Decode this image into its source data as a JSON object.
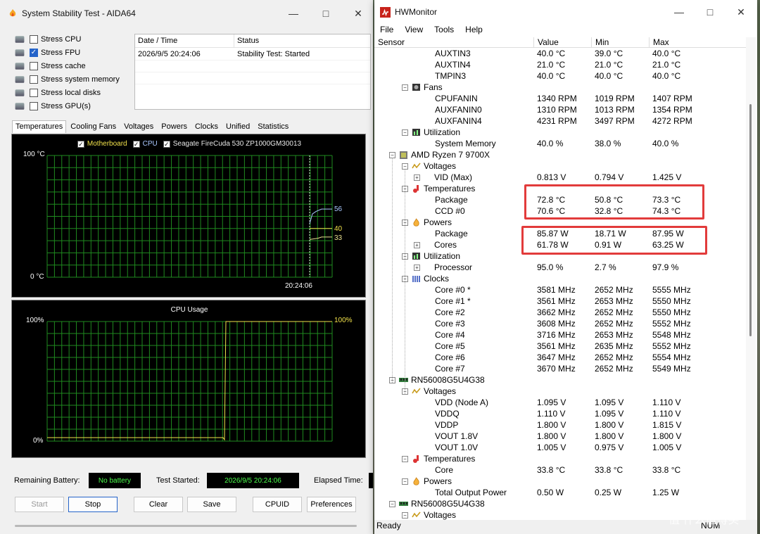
{
  "aida": {
    "title": "System Stability Test - AIDA64",
    "stress_items": [
      {
        "label": "Stress CPU",
        "checked": false,
        "icon": "cpu-chip-icon"
      },
      {
        "label": "Stress FPU",
        "checked": true,
        "icon": "fpu-icon"
      },
      {
        "label": "Stress cache",
        "checked": false,
        "icon": "cache-icon"
      },
      {
        "label": "Stress system memory",
        "checked": false,
        "icon": "memory-icon"
      },
      {
        "label": "Stress local disks",
        "checked": false,
        "icon": "disk-icon"
      },
      {
        "label": "Stress GPU(s)",
        "checked": false,
        "icon": "gpu-icon"
      }
    ],
    "log": {
      "col_datetime": "Date / Time",
      "col_status": "Status",
      "rows": [
        {
          "datetime": "2026/9/5 20:24:06",
          "status": "Stability Test: Started"
        }
      ]
    },
    "tabs": [
      "Temperatures",
      "Cooling Fans",
      "Voltages",
      "Powers",
      "Clocks",
      "Unified",
      "Statistics"
    ],
    "active_tab": "Temperatures",
    "temp_graph": {
      "legend": [
        "Motherboard",
        "CPU",
        "Seagate FireCuda 530 ZP1000GM30013"
      ],
      "y_max_label": "100 °C",
      "y_min_label": "0 °C",
      "time_label": "20:24:06",
      "readouts": [
        "56",
        "40",
        "33"
      ],
      "colors": {
        "motherboard": "#f2e24b",
        "cpu": "#aac8ff",
        "disk": "#e8e090",
        "grid": "#1f8a1f"
      }
    },
    "usage_graph": {
      "title": "CPU Usage",
      "y_max_label": "100%",
      "y_min_label": "0%",
      "readout": "100%"
    },
    "status": {
      "battery_label": "Remaining Battery:",
      "battery_value": "No battery",
      "started_label": "Test Started:",
      "started_value": "2026/9/5 20:24:06",
      "elapsed_label": "Elapsed Time:"
    },
    "buttons": {
      "start": "Start",
      "stop": "Stop",
      "clear": "Clear",
      "save": "Save",
      "cpuid": "CPUID",
      "preferences": "Preferences"
    }
  },
  "hwm": {
    "title": "HWMonitor",
    "menu": [
      "File",
      "View",
      "Tools",
      "Help"
    ],
    "columns": {
      "sensor": "Sensor",
      "value": "Value",
      "min": "Min",
      "max": "Max"
    },
    "rows": [
      {
        "level": 3,
        "name": "AUXTIN3",
        "value": "40.0 °C",
        "min": "39.0 °C",
        "max": "40.0 °C"
      },
      {
        "level": 3,
        "name": "AUXTIN4",
        "value": "21.0 °C",
        "min": "21.0 °C",
        "max": "21.0 °C"
      },
      {
        "level": 3,
        "name": "TMPIN3",
        "value": "40.0 °C",
        "min": "40.0 °C",
        "max": "40.0 °C"
      },
      {
        "level": 2,
        "name": "Fans",
        "icon": "fan-icon"
      },
      {
        "level": 3,
        "name": "CPUFANIN",
        "value": "1340 RPM",
        "min": "1019 RPM",
        "max": "1407 RPM"
      },
      {
        "level": 3,
        "name": "AUXFANIN0",
        "value": "1310 RPM",
        "min": "1013 RPM",
        "max": "1354 RPM"
      },
      {
        "level": 3,
        "name": "AUXFANIN4",
        "value": "4231 RPM",
        "min": "3497 RPM",
        "max": "4272 RPM"
      },
      {
        "level": 2,
        "name": "Utilization",
        "icon": "utilization-icon"
      },
      {
        "level": 3,
        "name": "System Memory",
        "value": "40.0 %",
        "min": "38.0 %",
        "max": "40.0 %"
      },
      {
        "level": 1,
        "name": "AMD Ryzen 7 9700X",
        "icon": "cpu-chip-icon"
      },
      {
        "level": 2,
        "name": "Voltages",
        "icon": "voltage-icon"
      },
      {
        "level": 3,
        "name": "VID (Max)",
        "value": "0.813 V",
        "min": "0.794 V",
        "max": "1.425 V",
        "plus": true
      },
      {
        "level": 2,
        "name": "Temperatures",
        "icon": "thermometer-icon"
      },
      {
        "level": 3,
        "name": "Package",
        "value": "72.8 °C",
        "min": "50.8 °C",
        "max": "73.3 °C"
      },
      {
        "level": 3,
        "name": "CCD #0",
        "value": "70.6 °C",
        "min": "32.8 °C",
        "max": "74.3 °C"
      },
      {
        "level": 2,
        "name": "Powers",
        "icon": "power-flame-icon"
      },
      {
        "level": 3,
        "name": "Package",
        "value": "85.87 W",
        "min": "18.71 W",
        "max": "87.95 W"
      },
      {
        "level": 3,
        "name": "Cores",
        "value": "61.78 W",
        "min": "0.91 W",
        "max": "63.25 W",
        "plus": true
      },
      {
        "level": 2,
        "name": "Utilization",
        "icon": "utilization-icon"
      },
      {
        "level": 3,
        "name": "Processor",
        "value": "95.0 %",
        "min": "2.7 %",
        "max": "97.9 %",
        "plus": true
      },
      {
        "level": 2,
        "name": "Clocks",
        "icon": "clock-bars-icon"
      },
      {
        "level": 3,
        "name": "Core #0 *",
        "value": "3581 MHz",
        "min": "2652 MHz",
        "max": "5555 MHz"
      },
      {
        "level": 3,
        "name": "Core #1 *",
        "value": "3561 MHz",
        "min": "2653 MHz",
        "max": "5550 MHz"
      },
      {
        "level": 3,
        "name": "Core #2",
        "value": "3662 MHz",
        "min": "2652 MHz",
        "max": "5550 MHz"
      },
      {
        "level": 3,
        "name": "Core #3",
        "value": "3608 MHz",
        "min": "2652 MHz",
        "max": "5552 MHz"
      },
      {
        "level": 3,
        "name": "Core #4",
        "value": "3716 MHz",
        "min": "2653 MHz",
        "max": "5548 MHz"
      },
      {
        "level": 3,
        "name": "Core #5",
        "value": "3561 MHz",
        "min": "2635 MHz",
        "max": "5552 MHz"
      },
      {
        "level": 3,
        "name": "Core #6",
        "value": "3647 MHz",
        "min": "2652 MHz",
        "max": "5554 MHz"
      },
      {
        "level": 3,
        "name": "Core #7",
        "value": "3670 MHz",
        "min": "2652 MHz",
        "max": "5549 MHz"
      },
      {
        "level": 1,
        "name": "RN56008G5U4G38",
        "icon": "memory-stick-icon"
      },
      {
        "level": 2,
        "name": "Voltages",
        "icon": "voltage-icon"
      },
      {
        "level": 3,
        "name": "VDD (Node A)",
        "value": "1.095 V",
        "min": "1.095 V",
        "max": "1.110 V"
      },
      {
        "level": 3,
        "name": "VDDQ",
        "value": "1.110 V",
        "min": "1.095 V",
        "max": "1.110 V"
      },
      {
        "level": 3,
        "name": "VDDP",
        "value": "1.800 V",
        "min": "1.800 V",
        "max": "1.815 V"
      },
      {
        "level": 3,
        "name": "VOUT 1.8V",
        "value": "1.800 V",
        "min": "1.800 V",
        "max": "1.800 V"
      },
      {
        "level": 3,
        "name": "VOUT 1.0V",
        "value": "1.005 V",
        "min": "0.975 V",
        "max": "1.005 V"
      },
      {
        "level": 2,
        "name": "Temperatures",
        "icon": "thermometer-icon"
      },
      {
        "level": 3,
        "name": "Core",
        "value": "33.8 °C",
        "min": "33.8 °C",
        "max": "33.8 °C"
      },
      {
        "level": 2,
        "name": "Powers",
        "icon": "power-flame-icon"
      },
      {
        "level": 3,
        "name": "Total Output Power",
        "value": "0.50 W",
        "min": "0.25 W",
        "max": "1.25 W"
      },
      {
        "level": 1,
        "name": "RN56008G5U4G38",
        "icon": "memory-stick-icon"
      },
      {
        "level": 2,
        "name": "Voltages",
        "icon": "voltage-icon"
      }
    ],
    "status_left": "Ready",
    "status_right": "NUM",
    "highlight_color": "#e23b3b"
  },
  "watermark": "值 什么值得买"
}
